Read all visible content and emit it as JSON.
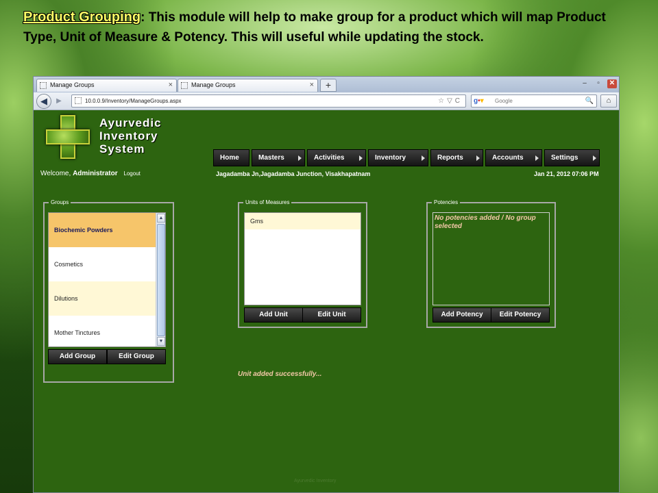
{
  "slide": {
    "title_highlight": "Product Grouping",
    "title_rest": ": This module will help to make group for a product which will map Product Type, Unit of Measure & Potency. This will useful while updating the stock."
  },
  "browser": {
    "tabs": [
      {
        "label": "Manage Groups",
        "close": "×"
      },
      {
        "label": "Manage Groups",
        "close": "×"
      }
    ],
    "new_tab": "+",
    "window_buttons": [
      "–",
      "▫",
      "✕"
    ],
    "url": "10.0.0.9/Inventory/ManageGroups.aspx",
    "search_placeholder": "Google",
    "back_glyph": "◀",
    "forward_glyph": "▶",
    "home_glyph": "⌂",
    "url_tools": "☆▽C",
    "search_glyph": "🔍"
  },
  "app": {
    "logo_lines": [
      "Ayurvedic",
      "Inventory",
      "System"
    ],
    "welcome_prefix": "Welcome, ",
    "welcome_user": "Administrator",
    "logout": "Logout",
    "menu": [
      "Home",
      "Masters",
      "Activities",
      "Inventory",
      "Reports",
      "Accounts",
      "Settings"
    ],
    "location": "Jagadamba Jn,Jagadamba Junction, Visakhapatnam",
    "datetime": "Jan 21, 2012 07:06 PM",
    "groups": {
      "legend": "Groups",
      "items": [
        "Biochemic Powders",
        "Cosmetics",
        "Dilutions",
        "Mother Tinctures"
      ],
      "selected_index": 0,
      "add_button": "Add Group",
      "edit_button": "Edit Group"
    },
    "units": {
      "legend": "Units of Measures",
      "items": [
        "Gms"
      ],
      "add_button": "Add Unit",
      "edit_button": "Edit Unit"
    },
    "potencies": {
      "legend": "Potencies",
      "empty_message": "No potencies added / No group selected",
      "add_button": "Add Potency",
      "edit_button": "Edit Potency"
    },
    "status_message": "Unit added successfully...",
    "footer": "Ayurvedic Inventory"
  }
}
